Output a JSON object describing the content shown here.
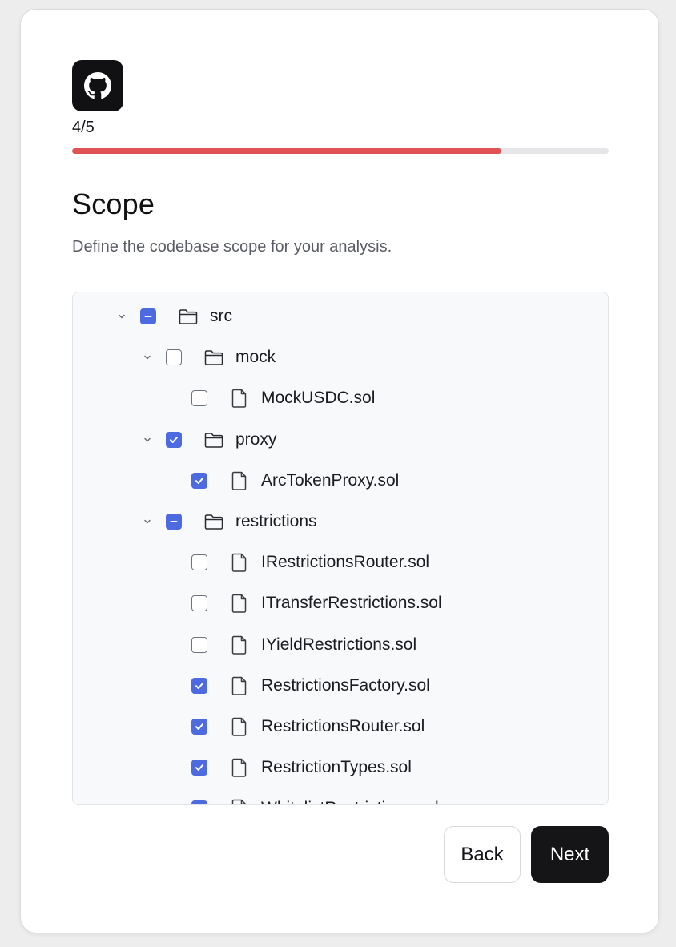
{
  "logo_icon": "github-icon",
  "step": {
    "text": "4/5",
    "current": 4,
    "total": 5,
    "progress_fraction": 0.8
  },
  "colors": {
    "progress": "#e05254",
    "checkbox_accent": "#4e6ae0",
    "primary_button": "#151518"
  },
  "title": "Scope",
  "subtitle": "Define the codebase scope for your analysis.",
  "tree": [
    {
      "label": "src",
      "type": "folder",
      "depth": 0,
      "state": "mixed",
      "expanded": true
    },
    {
      "label": "mock",
      "type": "folder",
      "depth": 1,
      "state": "unchecked",
      "expanded": true
    },
    {
      "label": "MockUSDC.sol",
      "type": "file",
      "depth": 2,
      "state": "unchecked"
    },
    {
      "label": "proxy",
      "type": "folder",
      "depth": 1,
      "state": "checked",
      "expanded": true
    },
    {
      "label": "ArcTokenProxy.sol",
      "type": "file",
      "depth": 2,
      "state": "checked"
    },
    {
      "label": "restrictions",
      "type": "folder",
      "depth": 1,
      "state": "mixed",
      "expanded": true
    },
    {
      "label": "IRestrictionsRouter.sol",
      "type": "file",
      "depth": 2,
      "state": "unchecked"
    },
    {
      "label": "ITransferRestrictions.sol",
      "type": "file",
      "depth": 2,
      "state": "unchecked"
    },
    {
      "label": "IYieldRestrictions.sol",
      "type": "file",
      "depth": 2,
      "state": "unchecked"
    },
    {
      "label": "RestrictionsFactory.sol",
      "type": "file",
      "depth": 2,
      "state": "checked"
    },
    {
      "label": "RestrictionsRouter.sol",
      "type": "file",
      "depth": 2,
      "state": "checked"
    },
    {
      "label": "RestrictionTypes.sol",
      "type": "file",
      "depth": 2,
      "state": "checked"
    },
    {
      "label": "WhitelistRestrictions.sol",
      "type": "file",
      "depth": 2,
      "state": "checked"
    }
  ],
  "buttons": {
    "back": "Back",
    "next": "Next"
  }
}
